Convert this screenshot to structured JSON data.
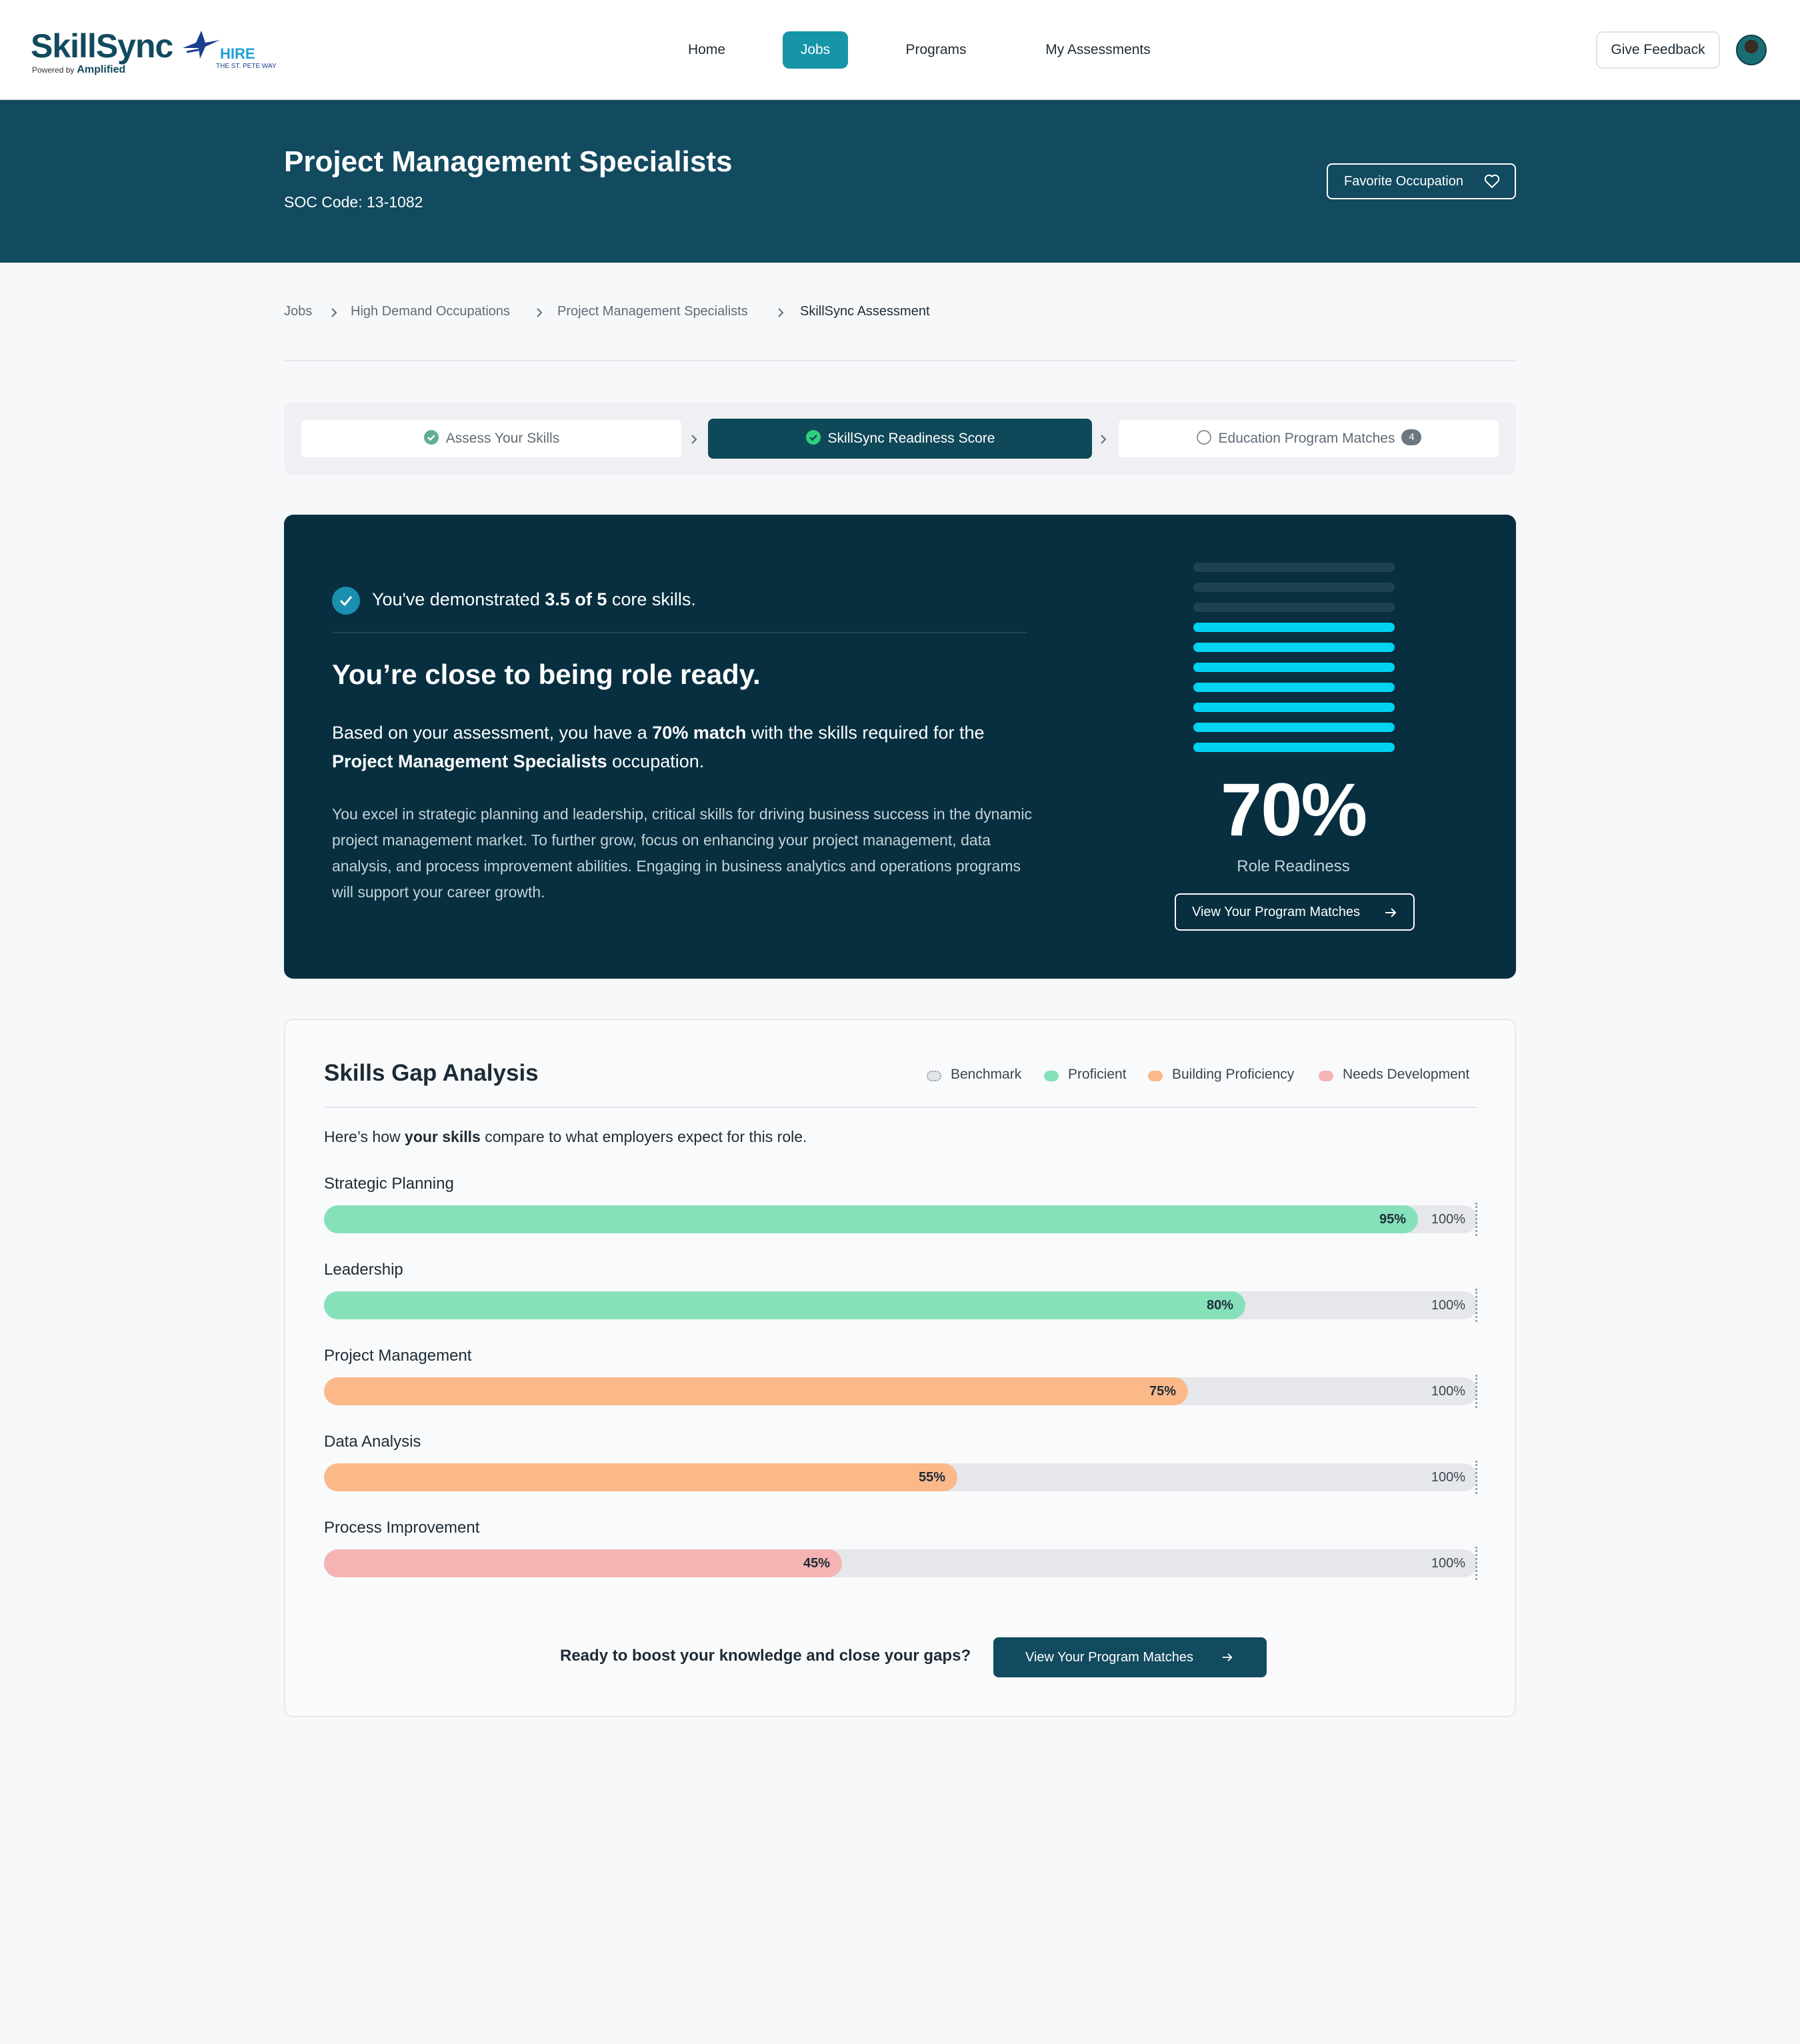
{
  "brand": {
    "name": "SkillSync",
    "powered_by": "Powered by",
    "powered_by_brand": "Amplified",
    "partner_logo_text": "HIRE",
    "partner_logo_sub": "THE ST. PETE WAY"
  },
  "nav": {
    "items": [
      {
        "label": "Home",
        "active": false
      },
      {
        "label": "Jobs",
        "active": true
      },
      {
        "label": "Programs",
        "active": false
      },
      {
        "label": "My Assessments",
        "active": false
      }
    ],
    "feedback_label": "Give Feedback"
  },
  "header": {
    "title": "Project Management Specialists",
    "soc_code": "SOC Code: 13-1082",
    "favorite_label": "Favorite Occupation"
  },
  "breadcrumb": [
    "Jobs",
    "High Demand Occupations",
    "Project Management Specialists",
    "SkillSync Assessment"
  ],
  "stepper": {
    "steps": [
      {
        "label": "Assess Your Skills",
        "state": "complete"
      },
      {
        "label": "SkillSync Readiness Score",
        "state": "active"
      },
      {
        "label": "Education Program Matches",
        "state": "pending",
        "badge": "4"
      }
    ]
  },
  "readiness": {
    "skills_prefix": "You've demonstrated ",
    "skills_count": "3.5 of 5",
    "skills_suffix": " core skills.",
    "headline": "You’re close to being role ready.",
    "desc_1": "Based on your assessment, you have a ",
    "desc_match": "70% match",
    "desc_2": " with the skills required for the ",
    "desc_occupation": "Project Management Specialists",
    "desc_3": " occupation.",
    "body": "You excel in strategic planning and leadership, critical skills for driving business success in the dynamic project management market. To further grow, focus on enhancing your project management, data analysis, and process improvement abilities. Engaging in business analytics and operations programs will support your career growth.",
    "score": "70%",
    "score_value": 70,
    "meter_total_bars": 10,
    "meter_filled_bars": 7,
    "score_label": "Role Readiness",
    "button_label": "View Your Program Matches"
  },
  "gap": {
    "title": "Skills Gap Analysis",
    "legend": [
      {
        "label": "Benchmark",
        "color": "#d7dadd"
      },
      {
        "label": "Proficient",
        "color": "#86e1bb"
      },
      {
        "label": "Building Proficiency",
        "color": "#fbb98a"
      },
      {
        "label": "Needs Development",
        "color": "#f6b3b3"
      }
    ],
    "intro_1": "Here’s how ",
    "intro_bold": "your skills",
    "intro_2": " compare to what employers expect for this role.",
    "benchmark_label": "100%",
    "skills": [
      {
        "name": "Strategic Planning",
        "value": 95,
        "label": "95%",
        "status": "Proficient",
        "color": "#86e1bb"
      },
      {
        "name": "Leadership",
        "value": 80,
        "label": "80%",
        "status": "Proficient",
        "color": "#86e1bb"
      },
      {
        "name": "Project Management",
        "value": 75,
        "label": "75%",
        "status": "Building Proficiency",
        "color": "#fbb98a"
      },
      {
        "name": "Data Analysis",
        "value": 55,
        "label": "55%",
        "status": "Building Proficiency",
        "color": "#fbb98a"
      },
      {
        "name": "Process Improvement",
        "value": 45,
        "label": "45%",
        "status": "Needs Development",
        "color": "#f6b3b3"
      }
    ],
    "cta_text": "Ready to boost your knowledge and close your gaps?",
    "cta_button": "View Your Program Matches"
  },
  "colors": {
    "brand_dark": "#124a5f",
    "nav_active": "#1695a8",
    "card_bg": "#072f40",
    "meter_on": "#00d4f2"
  }
}
